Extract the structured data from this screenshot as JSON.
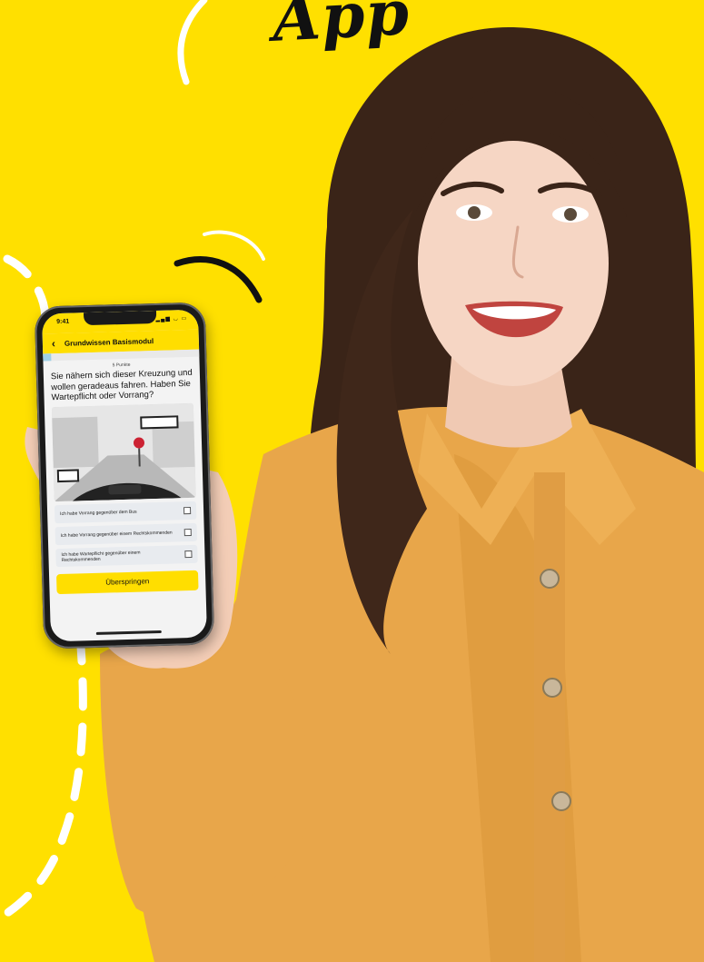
{
  "headline": "App",
  "colors": {
    "background": "#ffe000",
    "accent": "#ffde00",
    "shirt": "#e8a64a",
    "hair": "#3a2418",
    "progress": "#9fd0e6"
  },
  "phone": {
    "status_time": "9:41",
    "status_icons": "signal-wifi-battery-icons",
    "back_icon": "chevron-left-icon",
    "app_title": "Grundwissen Basismodul",
    "progress": 0.05,
    "points_label": "5 Punkte",
    "question": "Sie nähern sich dieser Kreuzung und wollen geradeaus fahren. Haben Sie Wartepflicht oder Vorrang?",
    "options": [
      "Ich habe Vorrang gegenüber dem Bus",
      "Ich habe Vorrang gegenüber einem Rechtskommenden",
      "Ich habe Wartepflicht gegenüber einem Rechtskommenden"
    ],
    "skip_label": "Überspringen"
  }
}
